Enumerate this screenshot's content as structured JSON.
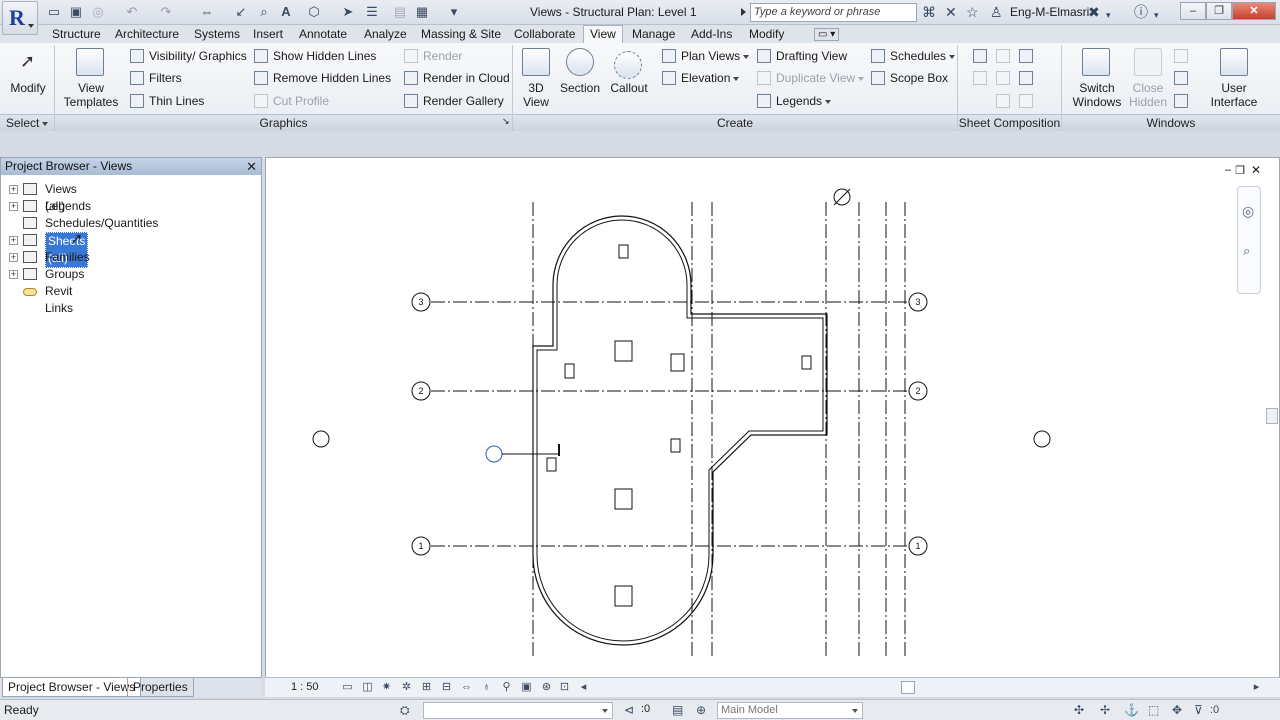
{
  "window": {
    "title": "Views - Structural Plan: Level 1",
    "search_placeholder": "Type a keyword or phrase",
    "user": "Eng-M-Elmasri"
  },
  "tabs": [
    "Structure",
    "Architecture",
    "Systems",
    "Insert",
    "Annotate",
    "Analyze",
    "Massing & Site",
    "Collaborate",
    "View",
    "Manage",
    "Add-Ins",
    "Modify"
  ],
  "active_tab": "View",
  "ribbon": {
    "select": {
      "modify": "Modify",
      "panel": "Select"
    },
    "graphics": {
      "panel": "Graphics",
      "view_templates": [
        "View",
        "Templates"
      ],
      "visibility": "Visibility/ Graphics",
      "filters": "Filters",
      "thin_lines": "Thin  Lines",
      "show_hidden": "Show  Hidden Lines",
      "remove_hidden": "Remove  Hidden Lines",
      "cut_profile": "Cut  Profile",
      "render": "Render",
      "render_cloud": "Render  in Cloud",
      "render_gallery": "Render  Gallery"
    },
    "create": {
      "panel": "Create",
      "view_3d": [
        "3D",
        "View"
      ],
      "section": "Section",
      "callout": "Callout",
      "plan_views": "Plan  Views",
      "elevation": "Elevation",
      "drafting_view": "Drafting  View",
      "duplicate_view": "Duplicate  View",
      "legends": "Legends",
      "schedules": "Schedules",
      "scope_box": "Scope  Box"
    },
    "sheet_composition": {
      "panel": "Sheet Composition"
    },
    "windows": {
      "panel": "Windows",
      "switch_windows": [
        "Switch",
        "Windows"
      ],
      "close_hidden": [
        "Close",
        "Hidden"
      ],
      "user_interface": [
        "User",
        "Interface"
      ]
    }
  },
  "browser": {
    "title": "Project Browser - Views",
    "items": [
      {
        "label": "Views (all)",
        "expandable": true,
        "selected": false
      },
      {
        "label": "Legends",
        "expandable": true,
        "selected": false
      },
      {
        "label": "Schedules/Quantities",
        "expandable": false,
        "selected": false
      },
      {
        "label": "Sheets (all)",
        "expandable": true,
        "selected": true
      },
      {
        "label": "Families",
        "expandable": true,
        "selected": false
      },
      {
        "label": "Groups",
        "expandable": true,
        "selected": false
      },
      {
        "label": "Revit Links",
        "expandable": false,
        "selected": false
      }
    ],
    "tabs": [
      "Project Browser - Views",
      "Properties"
    ]
  },
  "canvas": {
    "grid_labels": [
      "3",
      "2",
      "1"
    ],
    "scale": "1 : 50"
  },
  "status": {
    "text": "Ready",
    "filter_count": ":0",
    "model": "Main Model"
  },
  "colors": {
    "accent": "#3a78d8",
    "brand": "#1e3f9a"
  }
}
